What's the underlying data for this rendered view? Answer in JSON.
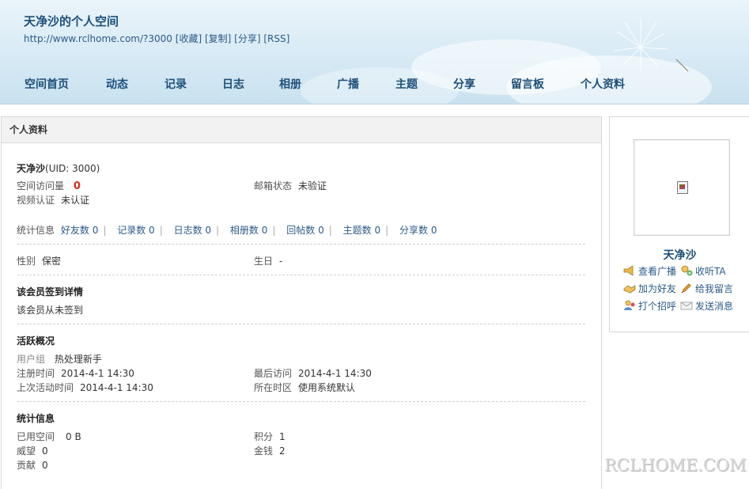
{
  "header": {
    "title": "天净沙的个人空间",
    "url": "http://www.rclhome.com/?3000",
    "links": [
      "[收藏]",
      "[复制]",
      "[分享]",
      "[RSS]"
    ]
  },
  "nav": [
    "空间首页",
    "动态",
    "记录",
    "日志",
    "相册",
    "广播",
    "主题",
    "分享",
    "留言板",
    "个人资料"
  ],
  "profile": {
    "panel_title": "个人资料",
    "name": "天净沙",
    "uid": "(UID: 3000)",
    "visits_label": "空间访问量",
    "visits_value": "0",
    "email_label": "邮箱状态",
    "email_value": "未验证",
    "video_label": "视频认证",
    "video_value": "未认证",
    "stats_label": "统计信息",
    "stats": [
      {
        "label": "好友数",
        "value": "0"
      },
      {
        "label": "记录数",
        "value": "0"
      },
      {
        "label": "日志数",
        "value": "0"
      },
      {
        "label": "相册数",
        "value": "0"
      },
      {
        "label": "回帖数",
        "value": "0"
      },
      {
        "label": "主题数",
        "value": "0"
      },
      {
        "label": "分享数",
        "value": "0"
      }
    ],
    "gender_label": "性别",
    "gender_value": "保密",
    "birthday_label": "生日",
    "birthday_value": "-",
    "checkin_title": "该会员签到详情",
    "checkin_text": "该会员从未签到",
    "activity_title": "活跃概况",
    "group_label": "用户组",
    "group_value": "热处理新手",
    "reg_label": "注册时间",
    "reg_value": "2014-4-1 14:30",
    "last_visit_label": "最后访问",
    "last_visit_value": "2014-4-1 14:30",
    "last_active_label": "上次活动时间",
    "last_active_value": "2014-4-1 14:30",
    "timezone_label": "所在时区",
    "timezone_value": "使用系统默认",
    "stat_title": "统计信息",
    "used_space_label": "已用空间",
    "used_space_value": "0 B",
    "points_label": "积分",
    "points_value": "1",
    "prestige_label": "威望",
    "prestige_value": "0",
    "money_label": "金钱",
    "money_value": "2",
    "contrib_label": "贡献",
    "contrib_value": "0"
  },
  "side": {
    "name": "天净沙",
    "actions": [
      {
        "label": "查看广播",
        "icon": "broadcast-icon"
      },
      {
        "label": "收听TA",
        "icon": "follow-icon"
      },
      {
        "label": "加为好友",
        "icon": "add-friend-icon"
      },
      {
        "label": "给我留言",
        "icon": "pencil-icon"
      },
      {
        "label": "打个招呼",
        "icon": "greet-icon"
      },
      {
        "label": "发送消息",
        "icon": "envelope-icon"
      }
    ]
  },
  "watermark": "RCLHOME.COM"
}
